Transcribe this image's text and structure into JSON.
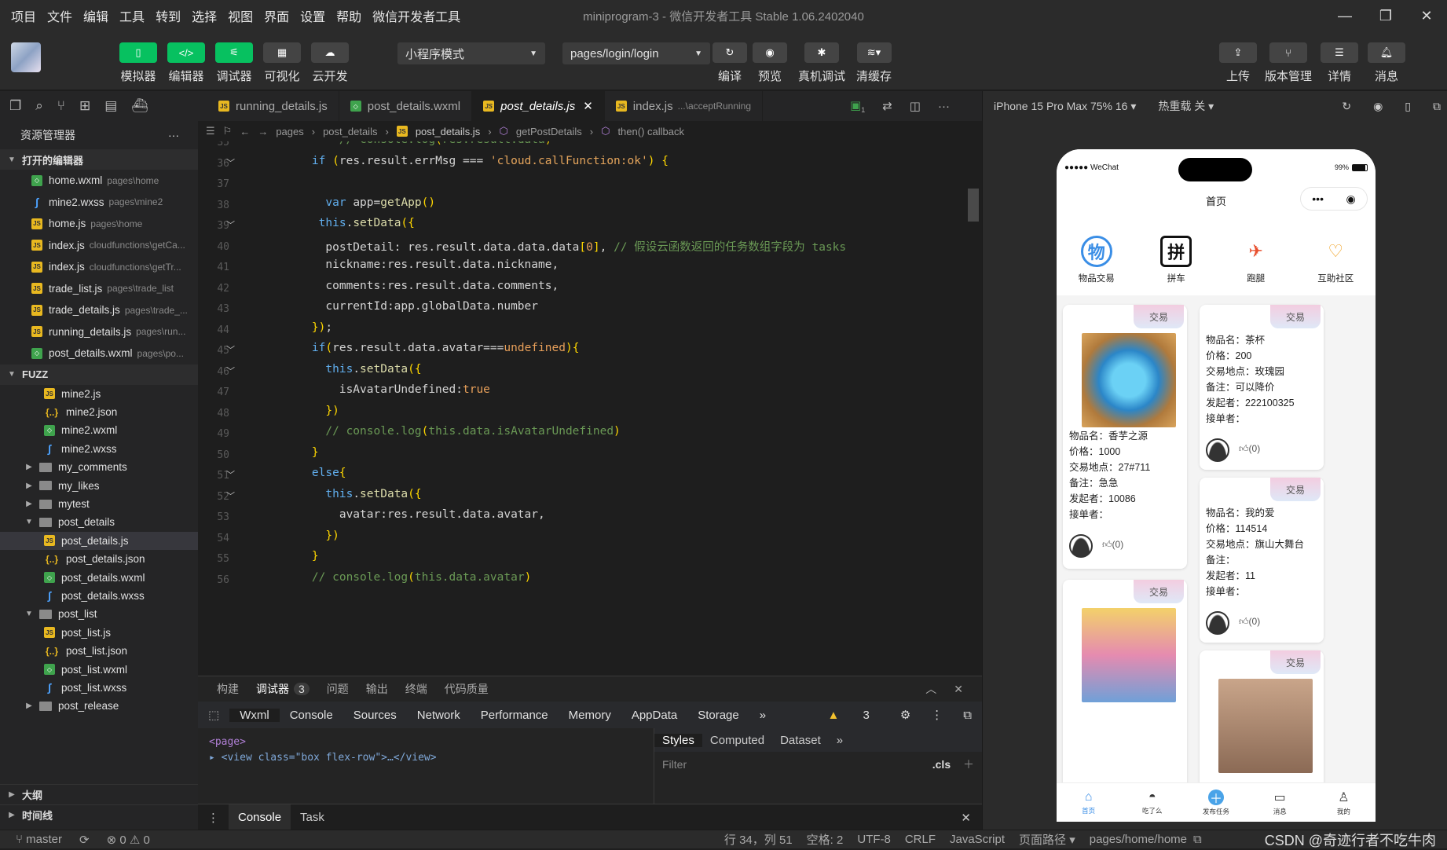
{
  "window": {
    "title": "miniprogram-3 - 微信开发者工具 Stable 1.06.2402040",
    "menu": [
      "项目",
      "文件",
      "编辑",
      "工具",
      "转到",
      "选择",
      "视图",
      "界面",
      "设置",
      "帮助",
      "微信开发者工具"
    ]
  },
  "toolbar": {
    "left": [
      "模拟器",
      "编辑器",
      "调试器",
      "可视化",
      "云开发"
    ],
    "mode": "小程序模式",
    "page": "pages/login/login",
    "mid": [
      "编译",
      "预览",
      "真机调试",
      "清缓存"
    ],
    "right": [
      "上传",
      "版本管理",
      "详情",
      "消息"
    ]
  },
  "explorer": {
    "title": "资源管理器",
    "open_section": "打开的编辑器",
    "open_files": [
      {
        "name": "home.wxml",
        "path": "pages\\home",
        "type": "wxml"
      },
      {
        "name": "mine2.wxss",
        "path": "pages\\mine2",
        "type": "wxss"
      },
      {
        "name": "home.js",
        "path": "pages\\home",
        "type": "js"
      },
      {
        "name": "index.js",
        "path": "cloudfunctions\\getCa...",
        "type": "js"
      },
      {
        "name": "index.js",
        "path": "cloudfunctions\\getTr...",
        "type": "js"
      },
      {
        "name": "trade_list.js",
        "path": "pages\\trade_list",
        "type": "js"
      },
      {
        "name": "trade_details.js",
        "path": "pages\\trade_...",
        "type": "js"
      },
      {
        "name": "running_details.js",
        "path": "pages\\run...",
        "type": "js"
      },
      {
        "name": "post_details.wxml",
        "path": "pages\\po...",
        "type": "wxml"
      }
    ],
    "project": "FUZZ",
    "tree": [
      {
        "name": "mine2.js",
        "type": "js",
        "indent": 2
      },
      {
        "name": "mine2.json",
        "type": "json",
        "indent": 2
      },
      {
        "name": "mine2.wxml",
        "type": "wxml",
        "indent": 2
      },
      {
        "name": "mine2.wxss",
        "type": "wxss",
        "indent": 2
      },
      {
        "name": "my_comments",
        "type": "folder",
        "indent": 1,
        "chev": "▶"
      },
      {
        "name": "my_likes",
        "type": "folder",
        "indent": 1,
        "chev": "▶"
      },
      {
        "name": "mytest",
        "type": "folder",
        "indent": 1,
        "chev": "▶"
      },
      {
        "name": "post_details",
        "type": "folder",
        "indent": 1,
        "chev": "▼"
      },
      {
        "name": "post_details.js",
        "type": "js",
        "indent": 2,
        "selected": true
      },
      {
        "name": "post_details.json",
        "type": "json",
        "indent": 2
      },
      {
        "name": "post_details.wxml",
        "type": "wxml",
        "indent": 2
      },
      {
        "name": "post_details.wxss",
        "type": "wxss",
        "indent": 2
      },
      {
        "name": "post_list",
        "type": "folder",
        "indent": 1,
        "chev": "▼"
      },
      {
        "name": "post_list.js",
        "type": "js",
        "indent": 2
      },
      {
        "name": "post_list.json",
        "type": "json",
        "indent": 2
      },
      {
        "name": "post_list.wxml",
        "type": "wxml",
        "indent": 2
      },
      {
        "name": "post_list.wxss",
        "type": "wxss",
        "indent": 2
      },
      {
        "name": "post_release",
        "type": "folder",
        "indent": 1,
        "chev": "▶"
      }
    ],
    "outline": "大纲",
    "timeline": "时间线"
  },
  "tabs": [
    {
      "label": "running_details.js",
      "icon": "js"
    },
    {
      "label": "post_details.wxml",
      "icon": "wxml"
    },
    {
      "label": "post_details.js",
      "icon": "js",
      "active": true
    },
    {
      "label": "index.js",
      "icon": "js",
      "hint": "...\\acceptRunning"
    }
  ],
  "breadcrumb": [
    "pages",
    "post_details",
    "post_details.js",
    "getPostDetails",
    "then() callback"
  ],
  "code": [
    {
      "n": "35",
      "t": "        <c>// console.log(res.result.data)</c>"
    },
    {
      "n": "36",
      "t": "    <k>if</k> (res.result.errMsg === <s>'cloud.callFunction:ok'</s>) {",
      "fold": 1
    },
    {
      "n": "37",
      "t": ""
    },
    {
      "n": "38",
      "t": "      <k>var</k> app=<f>getApp</f>()"
    },
    {
      "n": "39",
      "t": "     <k>this</k>.<f>setData</f>({",
      "fold": 1
    },
    {
      "n": "40",
      "t": "      postDetail: res.result.data.data.data[<o>0</o>], <c>// 假设云函数返回的任务数组字段为 tasks</c>"
    },
    {
      "n": "41",
      "t": "      nickname:res.result.data.nickname,"
    },
    {
      "n": "42",
      "t": "      comments:res.result.data.comments,"
    },
    {
      "n": "43",
      "t": "      currentId:app.globalData.number"
    },
    {
      "n": "44",
      "t": "    });"
    },
    {
      "n": "45",
      "t": "    <k>if</k>(res.result.data.avatar===<o>undefined</o>){",
      "fold": 1
    },
    {
      "n": "46",
      "t": "      <k>this</k>.<f>setData</f>({",
      "fold": 1
    },
    {
      "n": "47",
      "t": "        isAvatarUndefined:<o>true</o>"
    },
    {
      "n": "48",
      "t": "      })"
    },
    {
      "n": "49",
      "t": "      <c>// console.log(this.data.isAvatarUndefined)</c>"
    },
    {
      "n": "50",
      "t": "    }"
    },
    {
      "n": "51",
      "t": "    <k>else</k>{",
      "fold": 1
    },
    {
      "n": "52",
      "t": "      <k>this</k>.<f>setData</f>({",
      "fold": 1
    },
    {
      "n": "53",
      "t": "        avatar:res.result.data.avatar,"
    },
    {
      "n": "54",
      "t": "      })"
    },
    {
      "n": "55",
      "t": "    }"
    },
    {
      "n": "56",
      "t": "    <c>// console.log(this.data.avatar)</c>"
    }
  ],
  "devtools": {
    "top_tabs": [
      "构建",
      "调试器",
      "问题",
      "输出",
      "终端",
      "代码质量"
    ],
    "badge": "3",
    "tabs": [
      "Wxml",
      "Console",
      "Sources",
      "Network",
      "Performance",
      "Memory",
      "AppData",
      "Storage"
    ],
    "warn": "3",
    "dom1": "<page>",
    "dom2": "<view class=\"box flex-row\">…</view>",
    "style_tabs": [
      "Styles",
      "Computed",
      "Dataset"
    ],
    "filter": "Filter",
    "cls": ".cls",
    "console_tabs": [
      "Console",
      "Task"
    ]
  },
  "phone": {
    "device": "iPhone 15 Pro Max 75% 16",
    "hotreload": "热重载 关",
    "carrier": "●●●●● WeChat",
    "battery": "99%",
    "page_title": "首页",
    "icons": [
      "物品交易",
      "拼车",
      "跑腿",
      "互助社区"
    ],
    "cards": [
      {
        "tag": "交易",
        "lines": [
          "物品名：香芋之源",
          "价格：1000",
          "交易地点：27#711",
          "备注：急急",
          "发起者：10086",
          "接单者："
        ],
        "likes": "(0)"
      },
      {
        "tag": "交易",
        "lines": [
          "物品名：茶杯",
          "价格：200",
          "交易地点：玫瑰园",
          "备注：可以降价",
          "发起者：222100325",
          "接单者："
        ],
        "likes": "(0)"
      },
      {
        "tag": "交易",
        "lines": [
          "物品名：我的爱",
          "价格：114514",
          "交易地点：旗山大舞台",
          "备注：",
          "发起者：11",
          "接单者："
        ],
        "likes": "(0)"
      },
      {
        "tag": "交易"
      },
      {
        "tag": "交易"
      }
    ],
    "tabbar": [
      "首页",
      "吃了么",
      "发布任务",
      "消息",
      "我的"
    ]
  },
  "status": {
    "branch": "master",
    "errors": "0",
    "warnings": "0",
    "position": "行 34，列 51",
    "spaces": "空格: 2",
    "encoding": "UTF-8",
    "eol": "CRLF",
    "lang": "JavaScript",
    "route_label": "页面路径",
    "route": "pages/home/home",
    "watermark": "CSDN @奇迹行者不吃牛肉"
  }
}
